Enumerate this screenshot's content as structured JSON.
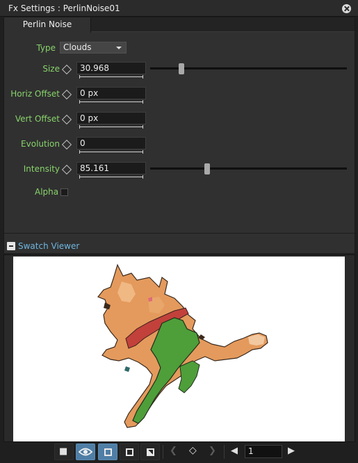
{
  "window": {
    "title": "Fx Settings : PerlinNoise01"
  },
  "tabs": [
    {
      "label": "Perlin Noise"
    }
  ],
  "params": {
    "type": {
      "label": "Type",
      "value": "Clouds"
    },
    "size": {
      "label": "Size",
      "value": "30.968",
      "slider": 0.16
    },
    "horiz_offset": {
      "label": "Horiz Offset",
      "value": "0 px"
    },
    "vert_offset": {
      "label": "Vert Offset",
      "value": "0 px"
    },
    "evolution": {
      "label": "Evolution",
      "value": "0"
    },
    "intensity": {
      "label": "Intensity",
      "value": "85.161",
      "slider": 0.29
    },
    "alpha": {
      "label": "Alpha",
      "checked": false
    }
  },
  "swatch": {
    "label": "Swatch Viewer"
  },
  "toolbar": {
    "frame": "1"
  },
  "colors": {
    "label_green": "#88d36b",
    "accent_blue": "#4f7ea6",
    "link_blue": "#6fb6e0"
  }
}
